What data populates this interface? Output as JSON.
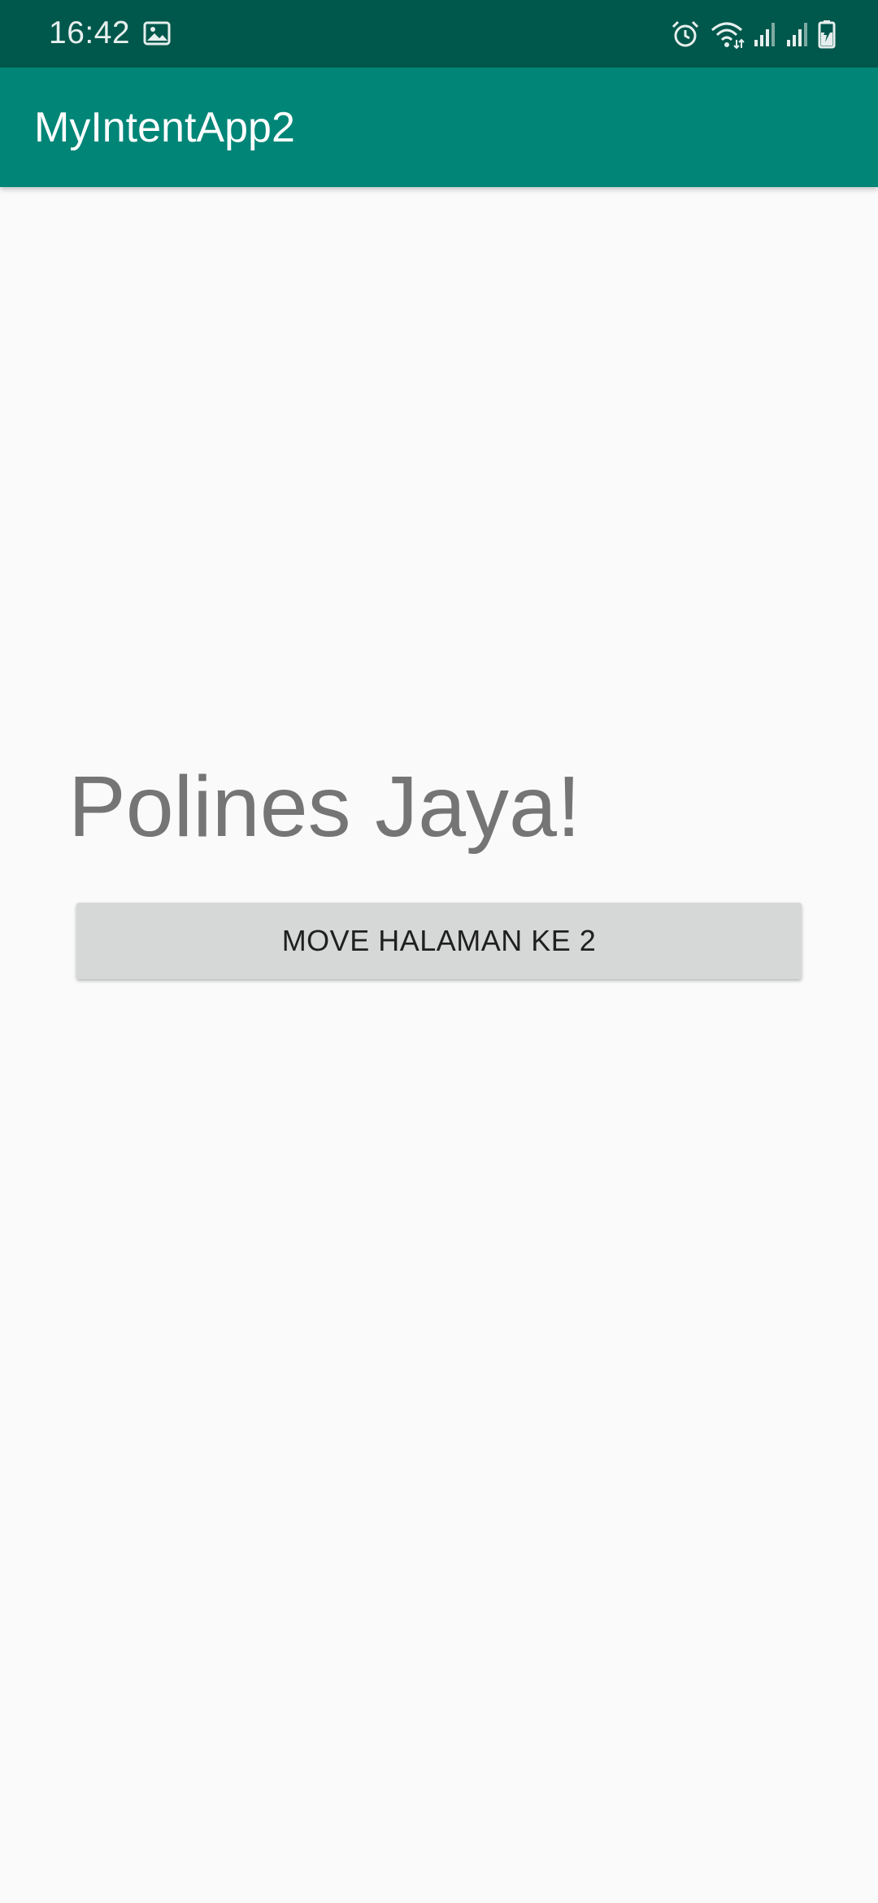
{
  "status_bar": {
    "time": "16:42",
    "left_icons": [
      "image-icon"
    ],
    "right_icons": [
      "alarm-icon",
      "wifi-icon",
      "signal-icon",
      "signal-icon",
      "battery-charging-icon"
    ],
    "background_color": "#00574b"
  },
  "app_bar": {
    "title": "MyIntentApp2",
    "background_color": "#008577"
  },
  "main": {
    "headline": "Polines Jaya!",
    "move_button_label": "MOVE HALAMAN KE 2"
  }
}
